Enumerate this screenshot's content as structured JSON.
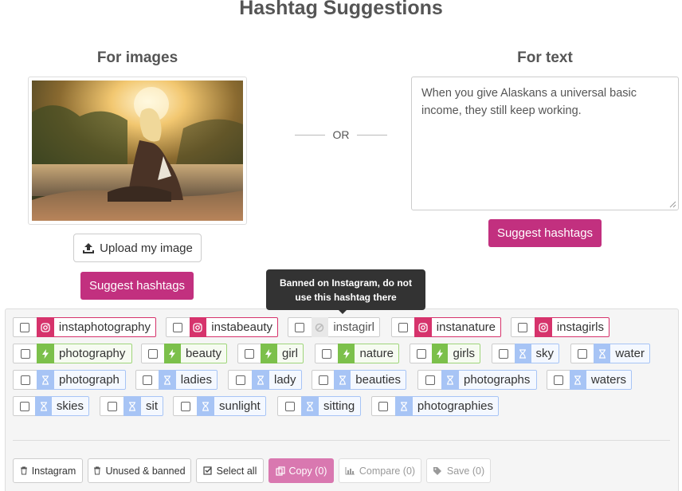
{
  "page": {
    "title": "Hashtag Suggestions",
    "or_label": "OR"
  },
  "images": {
    "heading": "For images",
    "upload_label": "Upload my image",
    "suggest_label": "Suggest hashtags"
  },
  "text": {
    "heading": "For text",
    "value": "When you give Alaskans a universal basic income, they still keep working.",
    "suggest_label": "Suggest hashtags"
  },
  "tooltip": {
    "text": "Banned on Instagram, do not use this hashtag there"
  },
  "tags": [
    {
      "label": "instaphotography",
      "kind": "insta"
    },
    {
      "label": "instabeauty",
      "kind": "insta"
    },
    {
      "label": "instagirl",
      "kind": "banned"
    },
    {
      "label": "instanature",
      "kind": "insta"
    },
    {
      "label": "instagirls",
      "kind": "insta"
    },
    {
      "label": "photography",
      "kind": "hot"
    },
    {
      "label": "beauty",
      "kind": "hot"
    },
    {
      "label": "girl",
      "kind": "hot"
    },
    {
      "label": "nature",
      "kind": "hot"
    },
    {
      "label": "girls",
      "kind": "hot"
    },
    {
      "label": "sky",
      "kind": "pending"
    },
    {
      "label": "water",
      "kind": "pending"
    },
    {
      "label": "photograph",
      "kind": "pending"
    },
    {
      "label": "ladies",
      "kind": "pending"
    },
    {
      "label": "lady",
      "kind": "pending"
    },
    {
      "label": "beauties",
      "kind": "pending"
    },
    {
      "label": "photographs",
      "kind": "pending"
    },
    {
      "label": "waters",
      "kind": "pending"
    },
    {
      "label": "skies",
      "kind": "pending"
    },
    {
      "label": "sit",
      "kind": "pending"
    },
    {
      "label": "sunlight",
      "kind": "pending"
    },
    {
      "label": "sitting",
      "kind": "pending"
    },
    {
      "label": "photographies",
      "kind": "pending"
    }
  ],
  "actions": {
    "instagram": "Instagram",
    "unused_banned": "Unused & banned",
    "select_all": "Select all",
    "copy": "Copy (0)",
    "compare": "Compare (0)",
    "save": "Save (0)"
  },
  "colors": {
    "primary": "#c2307f",
    "instagram": "#d6336c",
    "hot": "#7cc04b",
    "pending": "#a7c4f5",
    "banned": "#cccccc"
  }
}
